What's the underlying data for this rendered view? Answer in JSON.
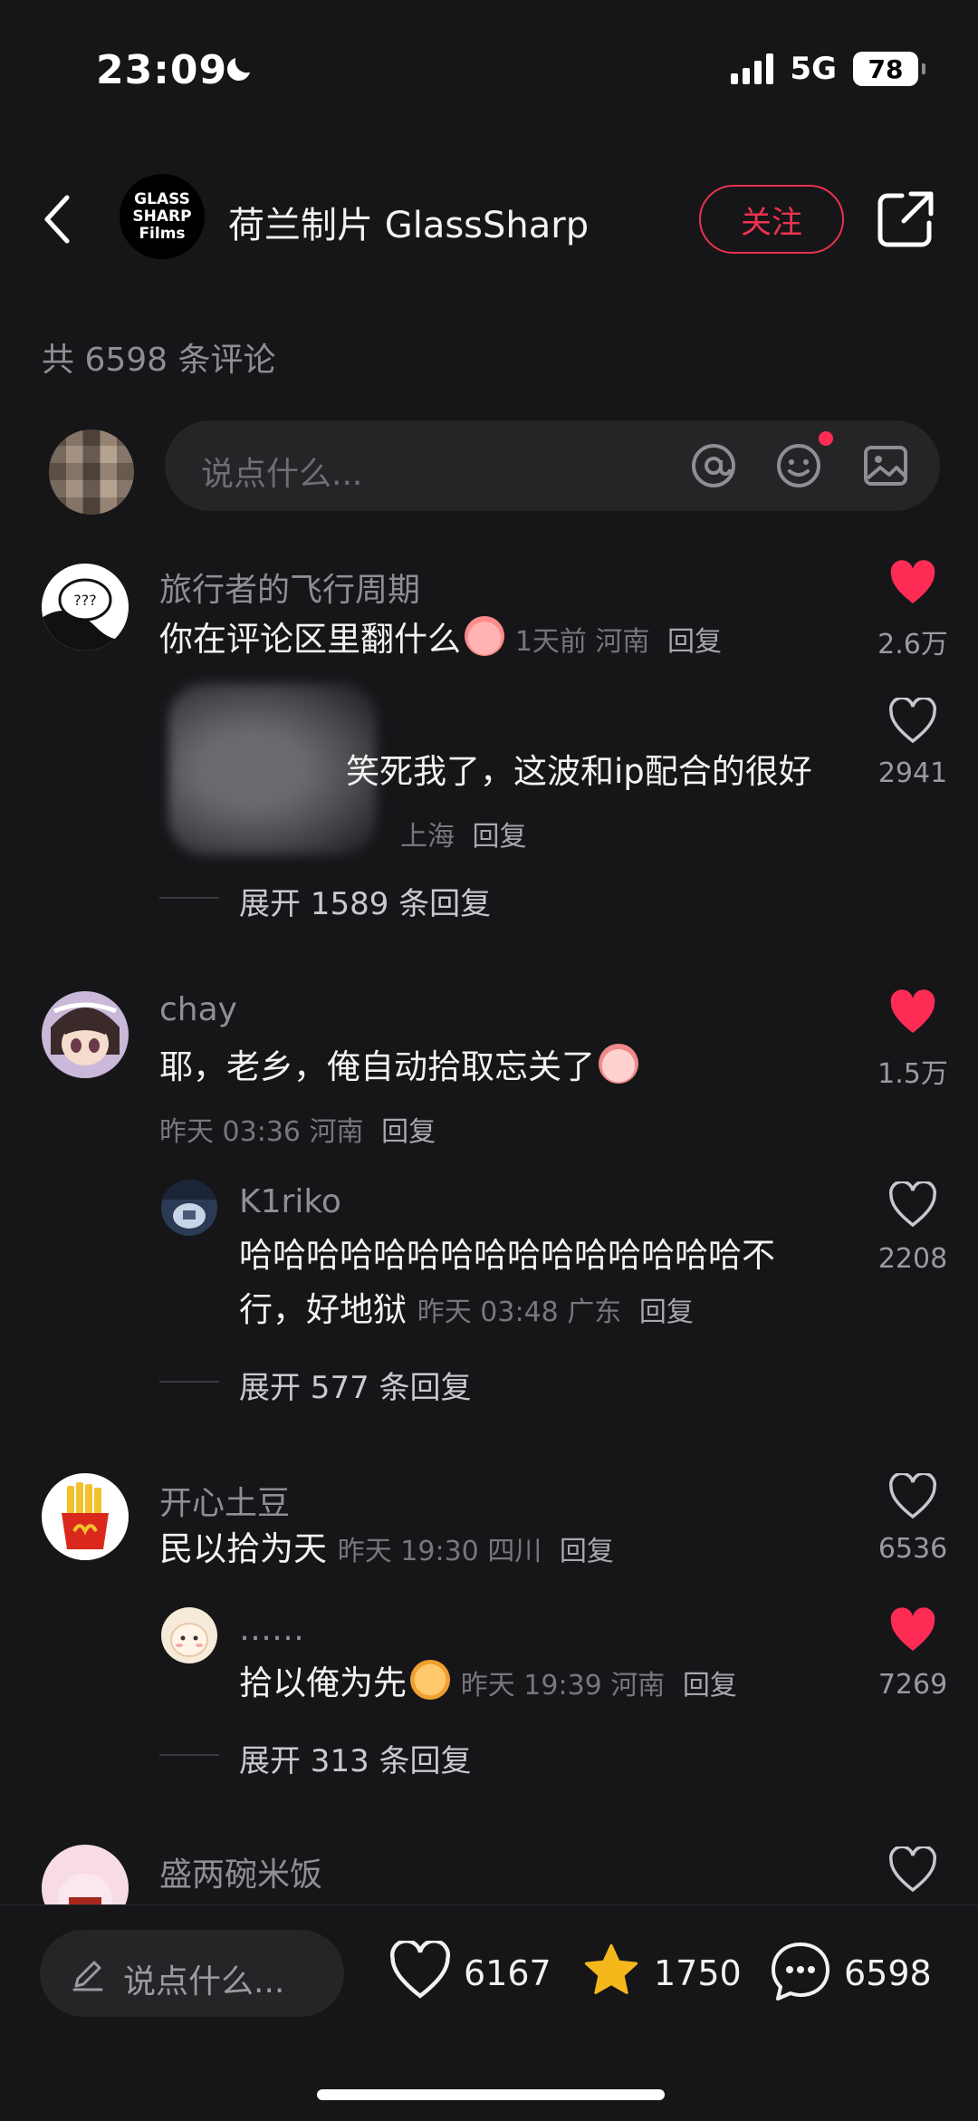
{
  "status_bar": {
    "time": "23:09",
    "network": "5G",
    "battery": "78"
  },
  "header": {
    "account_logo_text": [
      "GLASS",
      "SHARP",
      "Films"
    ],
    "account_name": "荷兰制片 GlassSharp",
    "follow_label": "关注"
  },
  "comment_count": "共 6598 条评论",
  "input": {
    "placeholder": "说点什么..."
  },
  "comments": [
    {
      "user": "旅行者的飞行周期",
      "text": "你在评论区里翻什么",
      "time": "1天前",
      "location": "河南",
      "reply": "回复",
      "likes": "2.6万",
      "liked": true,
      "replies": [
        {
          "user": "",
          "text": "笑死我了，这波和ip配合的很好",
          "time": "",
          "location": "上海",
          "reply": "回复",
          "likes": "2941",
          "liked": false
        }
      ],
      "expand": "展开 1589 条回复"
    },
    {
      "user": "chay",
      "text": "耶，老乡，俺自动拾取忘关了",
      "time": "昨天 03:36",
      "location": "河南",
      "reply": "回复",
      "likes": "1.5万",
      "liked": true,
      "replies": [
        {
          "user": "K1riko",
          "text_line1": "哈哈哈哈哈哈哈哈哈哈哈哈哈哈哈不",
          "text_line2": "行，好地狱",
          "time": "昨天 03:48",
          "location": "广东",
          "reply": "回复",
          "likes": "2208",
          "liked": false
        }
      ],
      "expand": "展开 577 条回复"
    },
    {
      "user": "开心土豆",
      "text": "民以拾为天",
      "time": "昨天 19:30",
      "location": "四川",
      "reply": "回复",
      "likes": "6536",
      "liked": false,
      "replies": [
        {
          "user": "……",
          "text": "拾以俺为先",
          "time": "昨天 19:39",
          "location": "河南",
          "reply": "回复",
          "likes": "7269",
          "liked": true
        }
      ],
      "expand": "展开 313 条回复"
    },
    {
      "user": "盛两碗米饭",
      "liked": false
    }
  ],
  "bottom_bar": {
    "placeholder": "说点什么...",
    "likes": "6167",
    "favorites": "1750",
    "comments": "6598"
  },
  "colors": {
    "background": "#161619",
    "accent_red": "#fe2c55",
    "star_yellow": "#f5b81a"
  },
  "icons": [
    "chevron-left-icon",
    "share-icon",
    "at-icon",
    "emoji-icon",
    "image-icon",
    "heart-icon",
    "pencil-icon",
    "star-icon",
    "comment-bubble-icon"
  ]
}
